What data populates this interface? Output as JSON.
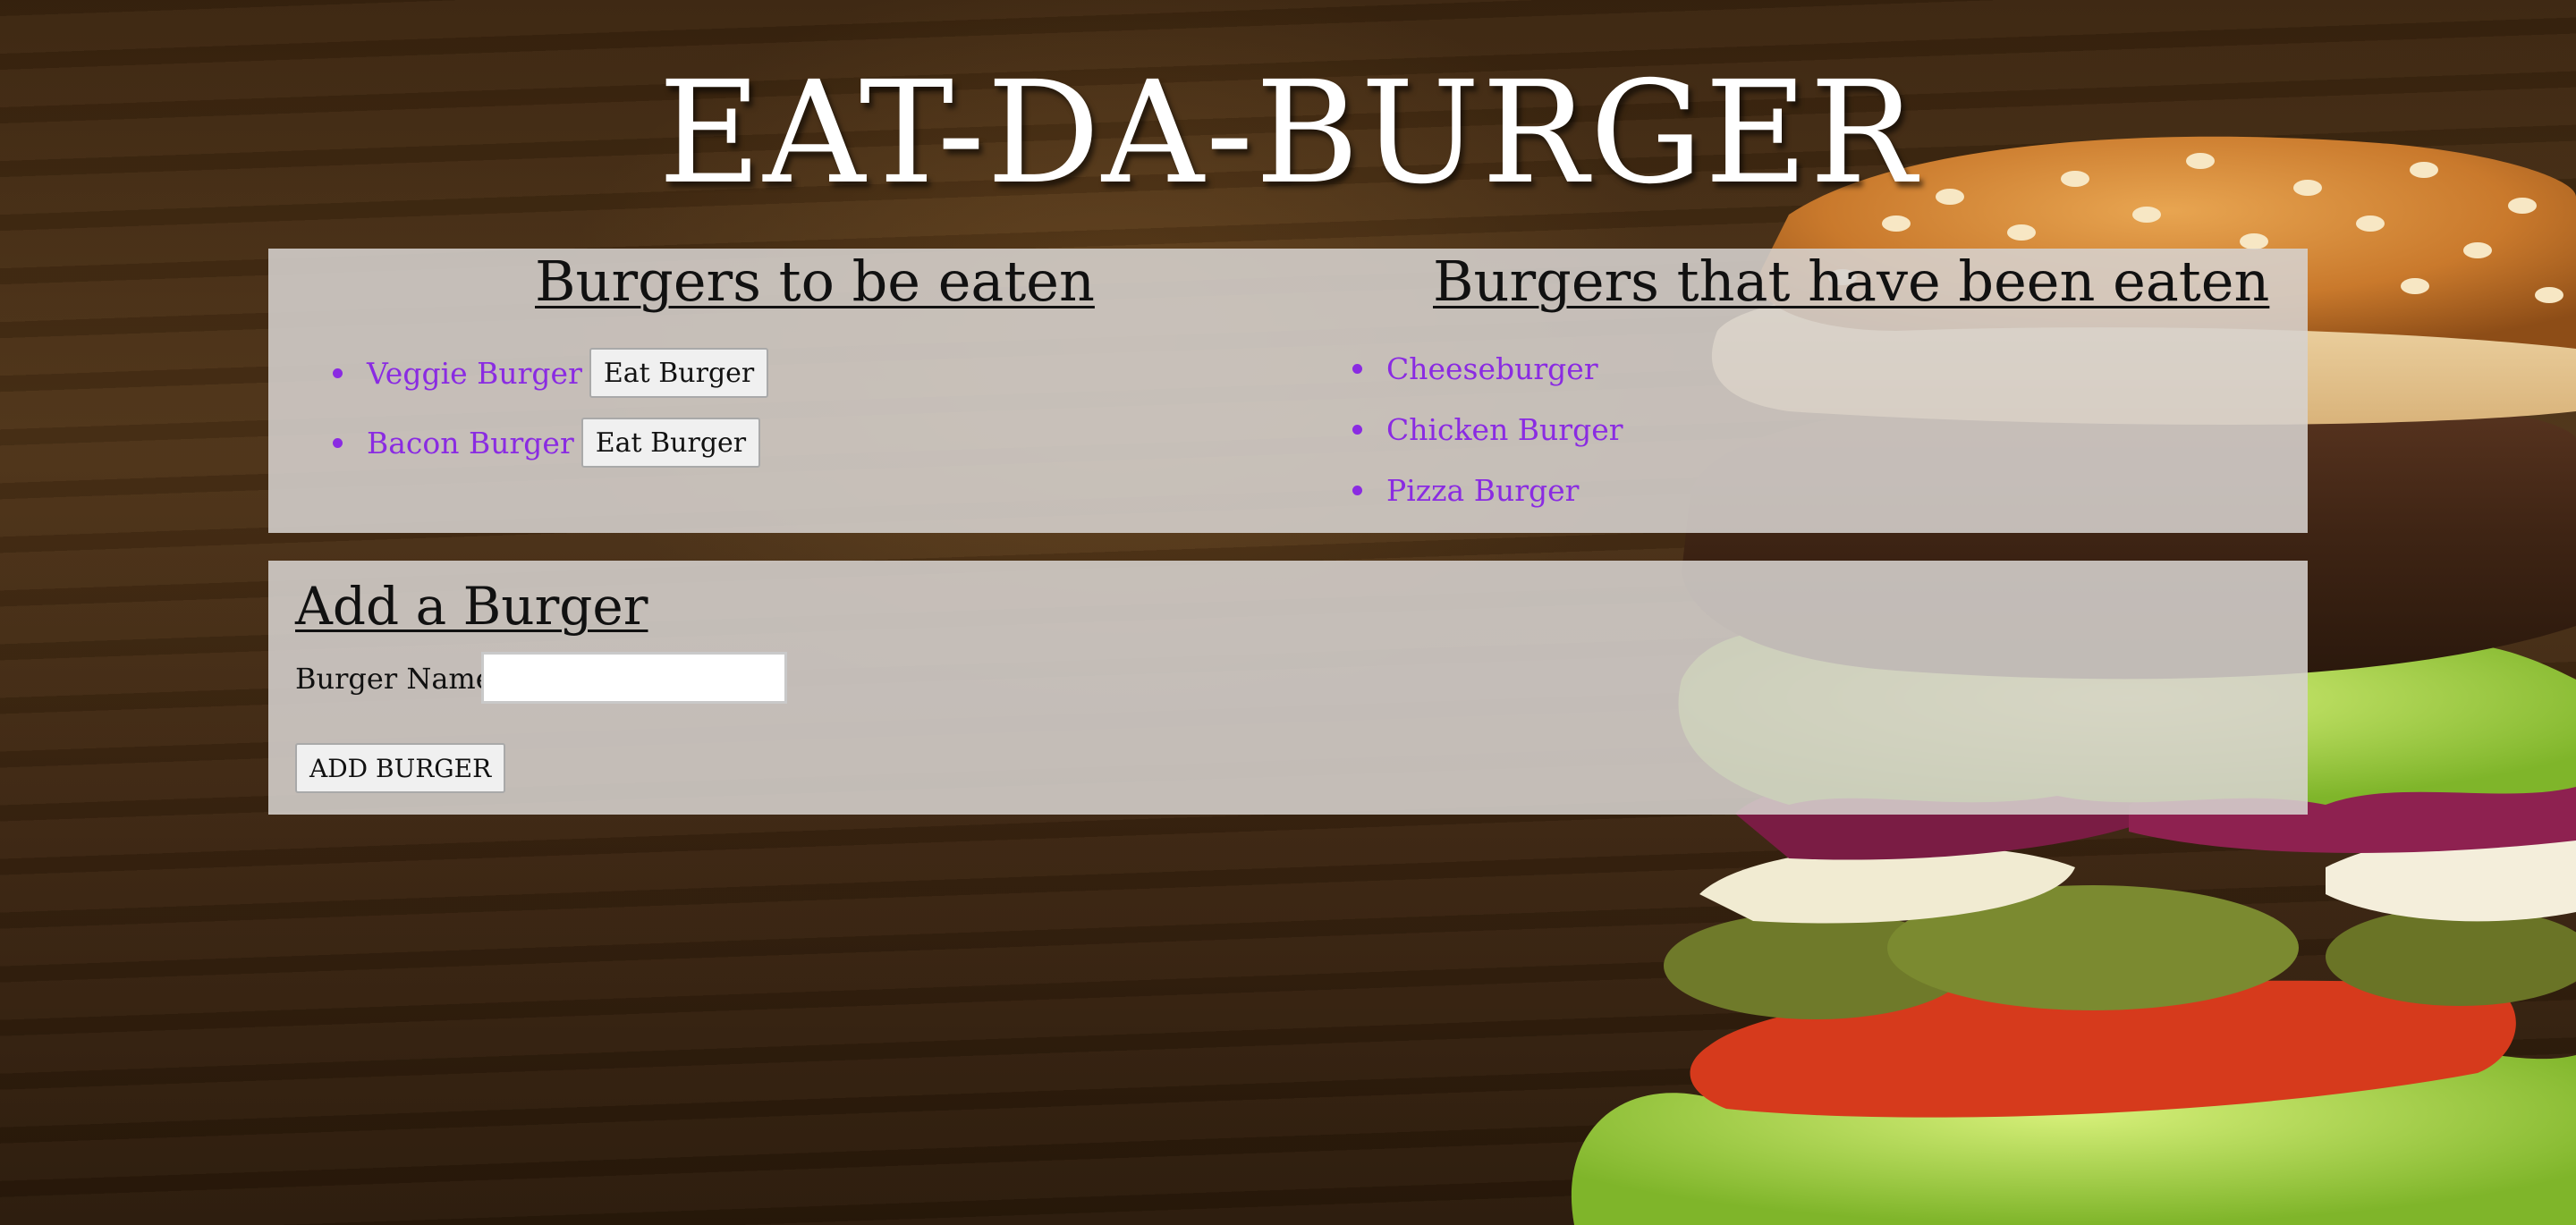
{
  "page": {
    "title": "EAT-DA-BURGER"
  },
  "uneaten": {
    "heading": "Burgers to be eaten",
    "items": [
      {
        "name": "Veggie Burger",
        "button": "Eat Burger"
      },
      {
        "name": "Bacon Burger",
        "button": "Eat Burger"
      }
    ]
  },
  "eaten": {
    "heading": "Burgers that have been eaten",
    "items": [
      {
        "name": "Cheeseburger"
      },
      {
        "name": "Chicken Burger"
      },
      {
        "name": "Pizza Burger"
      }
    ]
  },
  "add_form": {
    "heading": "Add a Burger",
    "label": "Burger Name:",
    "input_value": "",
    "button": "ADD BURGER"
  },
  "colors": {
    "link": "#8a2be2",
    "panel": "#d6d2ce",
    "background": "#3b250f"
  }
}
